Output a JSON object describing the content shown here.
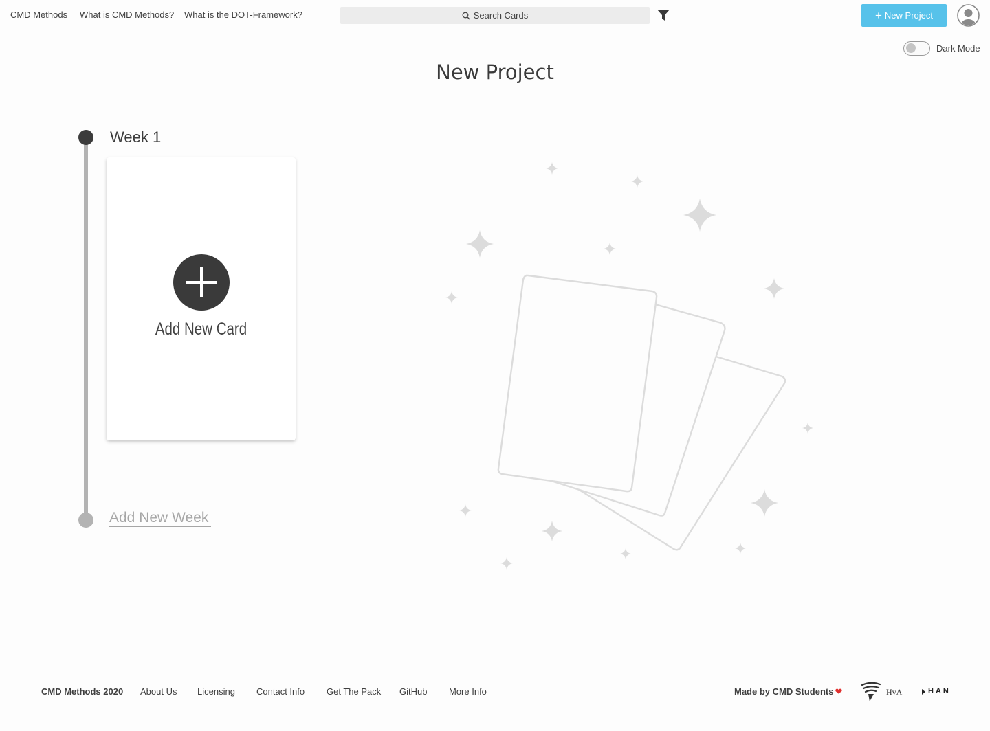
{
  "nav": {
    "links": [
      "CMD Methods",
      "What is CMD Methods?",
      "What is the DOT-Framework?"
    ],
    "search_placeholder": "Search Cards",
    "new_project_label": "New Project",
    "dark_mode_label": "Dark Mode",
    "dark_mode_on": false
  },
  "page": {
    "title": "New Project"
  },
  "timeline": {
    "weeks": [
      {
        "label": "Week 1"
      }
    ],
    "add_card_label": "Add New Card",
    "add_week_label": "Add New Week"
  },
  "footer": {
    "brand": "CMD Methods 2020",
    "links": [
      "About Us",
      "Licensing",
      "Contact Info",
      "Get The Pack",
      "GitHub",
      "More Info"
    ],
    "made_by": "Made by CMD Students",
    "heart": "❤",
    "partner_logos": [
      "HvA",
      "HAN"
    ]
  },
  "colors": {
    "accent": "#57c2ea",
    "dark": "#3a3a3a",
    "muted": "#b3b3b3",
    "illustration": "#dcdcdc"
  },
  "icons": [
    "search-icon",
    "filter-icon",
    "plus-icon",
    "user-avatar-icon",
    "sparkle-icon",
    "cards-illustration"
  ]
}
